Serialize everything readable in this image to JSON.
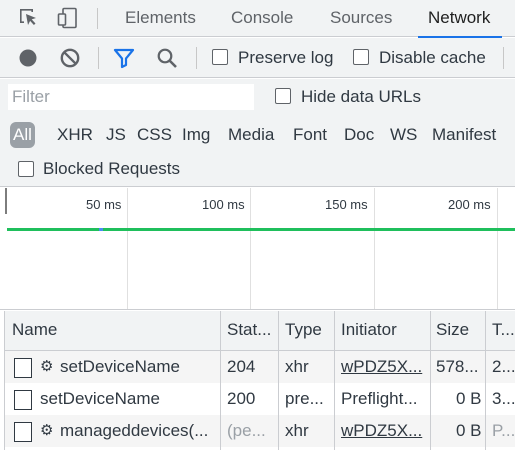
{
  "tabs": {
    "items": [
      "Elements",
      "Console",
      "Sources",
      "Network"
    ],
    "active": "Network"
  },
  "icons": {
    "inspect": "inspect-element-icon",
    "device": "device-toolbar-icon",
    "record": "record-icon",
    "clear": "clear-icon",
    "filter": "filter-icon",
    "search": "search-icon",
    "settings": "gear-icon"
  },
  "toolbar": {
    "preserve_log": "Preserve log",
    "disable_cache": "Disable cache"
  },
  "filter": {
    "placeholder": "Filter",
    "hide_data_urls": "Hide data URLs",
    "types": [
      "All",
      "XHR",
      "JS",
      "CSS",
      "Img",
      "Media",
      "Font",
      "Doc",
      "WS",
      "Manifest"
    ],
    "active_type": "All",
    "blocked_requests": "Blocked Requests"
  },
  "overview": {
    "ticks": [
      "50 ms",
      "100 ms",
      "150 ms",
      "200 ms"
    ]
  },
  "table": {
    "headers": [
      "Name",
      "Stat...",
      "Type",
      "Initiator",
      "Size",
      "T..."
    ],
    "rows": [
      {
        "name": "setDeviceName",
        "gear": true,
        "status": "204",
        "type": "xhr",
        "initiator": "wPDZ5X...",
        "initiator_link": true,
        "size": "578...",
        "time": "2..."
      },
      {
        "name": "setDeviceName",
        "gear": false,
        "status": "200",
        "type": "pre...",
        "initiator": "Preflight...",
        "initiator_link": false,
        "size": "0 B",
        "time": "3..."
      },
      {
        "name": "manageddevices(...",
        "gear": true,
        "status": "(pe...",
        "type": "xhr",
        "initiator": "wPDZ5X...",
        "initiator_link": true,
        "size": "0 B",
        "time": "P..."
      }
    ]
  },
  "colors": {
    "accent": "#1a73e8",
    "timeline_green": "#1fbf5c",
    "record": "#5f6368"
  }
}
